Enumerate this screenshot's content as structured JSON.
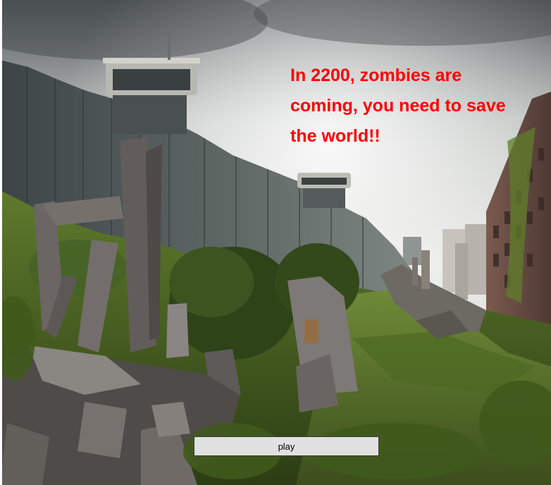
{
  "game": {
    "story_text": "In 2200, zombies are coming, you need to save the world!!",
    "play_label": "play"
  },
  "colors": {
    "story_text": "#ff0000",
    "play_button_bg": "#e1e1e1",
    "play_button_border": "#3a3a3a"
  }
}
